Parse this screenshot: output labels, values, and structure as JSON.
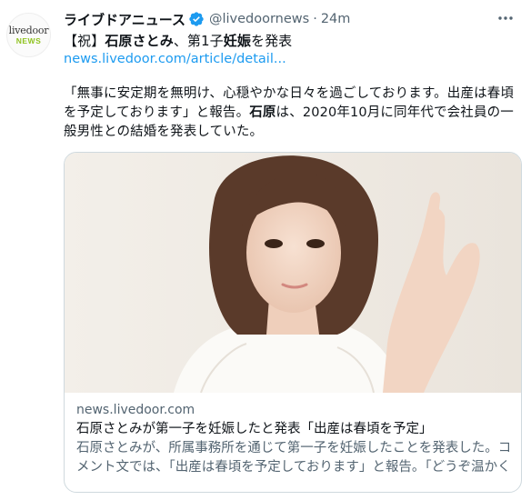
{
  "account": {
    "avatar_line1": "livedoor",
    "avatar_line2": "NEWS",
    "display_name": "ライブドアニュース",
    "handle": "@livedoornews",
    "separator": "·",
    "time": "24m"
  },
  "tweet": {
    "headline_parts": [
      "【祝】",
      "石原さとみ",
      "、第1子",
      "妊娠",
      "を発表"
    ],
    "link": "news.livedoor.com/article/detail...",
    "body_parts": [
      "「無事に安定期を無明け、心穏やかな日々を過ごしております。出産は春頃を予定しております」と報告。",
      "石原",
      "は、2020年10月に同年代で会社員の一般男性との結婚を発表していた。"
    ]
  },
  "card": {
    "domain": "news.livedoor.com",
    "title": "石原さとみが第一子を妊娠したと発表「出産は春頃を予定」",
    "description": "石原さとみが、所属事務所を通じて第一子を妊娠したことを発表した。コメント文では、「出産は春頃を予定しております」と報告。「どうぞ温かく見守っていただけたら幸いです」"
  },
  "colors": {
    "link": "#1d9bf0",
    "secondary_text": "#536471",
    "verified": "#1d9bf0",
    "border": "#cfd9de"
  },
  "icons": {
    "verified": "verified-badge-icon",
    "more": "more-options-icon"
  }
}
